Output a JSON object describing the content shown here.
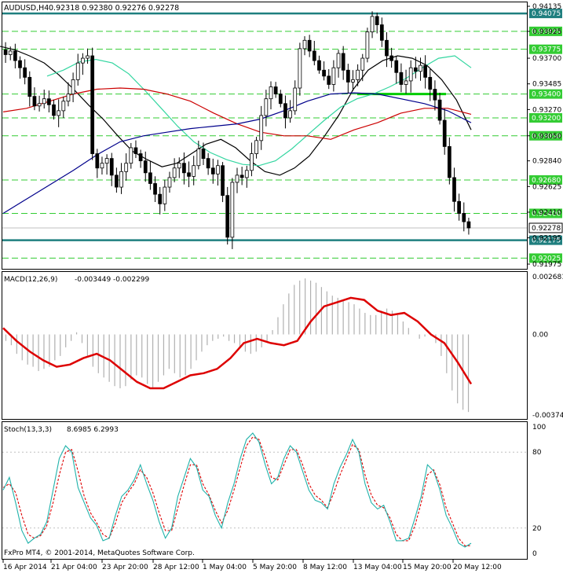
{
  "header": {
    "symbol": "AUDUSD,H4",
    "ohlc": "0.92318 0.92380 0.92276 0.92278"
  },
  "footer": {
    "copyright": "FxPro MT4, © 2001-2014, MetaQuotes Software Corp."
  },
  "chart_data": [
    {
      "type": "candlestick",
      "symbol": "AUDUSD",
      "timeframe": "H4",
      "ylim": [
        0.91975,
        0.94135
      ],
      "price_axis_labels": [
        "0.94135",
        "0.93925",
        "0.93700",
        "0.93485",
        "0.93270",
        "0.93050",
        "0.92840",
        "0.92625",
        "0.92410",
        "0.92195",
        "0.91975"
      ],
      "levels": [
        {
          "value": "0.94075",
          "style": "solid",
          "color": "#1f7f7f"
        },
        {
          "value": "0.93925",
          "style": "dashed",
          "color": "#33cc33"
        },
        {
          "value": "0.93775",
          "style": "dashed",
          "color": "#33cc33"
        },
        {
          "value": "0.93400",
          "style": "dashed",
          "color": "#33cc33"
        },
        {
          "value": "0.93200",
          "style": "dashed",
          "color": "#33cc33"
        },
        {
          "value": "0.93050",
          "style": "dashed",
          "color": "#33cc33"
        },
        {
          "value": "0.92680",
          "style": "dashed",
          "color": "#33cc33"
        },
        {
          "value": "0.92400",
          "style": "dashed",
          "color": "#33cc33"
        },
        {
          "value": "0.92175",
          "style": "solid",
          "color": "#1f7f7f"
        },
        {
          "value": "0.92025",
          "style": "dashed",
          "color": "#33cc33"
        }
      ],
      "current_price": "0.92278",
      "close_series": [
        0.9373,
        0.9376,
        0.9368,
        0.9362,
        0.9354,
        0.9338,
        0.933,
        0.9332,
        0.9336,
        0.9331,
        0.9322,
        0.9326,
        0.9334,
        0.934,
        0.9352,
        0.9366,
        0.937,
        0.9372,
        0.929,
        0.9278,
        0.9282,
        0.9286,
        0.9272,
        0.9262,
        0.9275,
        0.9282,
        0.9295,
        0.929,
        0.9284,
        0.9274,
        0.9265,
        0.9256,
        0.9248,
        0.9262,
        0.927,
        0.9278,
        0.9282,
        0.9274,
        0.9271,
        0.928,
        0.9294,
        0.9286,
        0.9278,
        0.9273,
        0.928,
        0.9255,
        0.922,
        0.9266,
        0.9272,
        0.927,
        0.9276,
        0.929,
        0.9301,
        0.9322,
        0.9336,
        0.9346,
        0.934,
        0.9332,
        0.932,
        0.9326,
        0.9345,
        0.9378,
        0.9385,
        0.9376,
        0.9368,
        0.936,
        0.9355,
        0.9348,
        0.9362,
        0.9374,
        0.936,
        0.935,
        0.9352,
        0.936,
        0.937,
        0.9392,
        0.9405,
        0.9398,
        0.9385,
        0.9372,
        0.9368,
        0.9358,
        0.9348,
        0.9351,
        0.9362,
        0.9359,
        0.9364,
        0.9354,
        0.9344,
        0.9335,
        0.9318,
        0.9296,
        0.927,
        0.925,
        0.924,
        0.9233,
        0.92278
      ],
      "moving_averages": [
        {
          "color": "#000000",
          "values": [
            0.938,
            0.9377,
            0.9372,
            0.9366,
            0.9356,
            0.9344,
            0.9331,
            0.9319,
            0.9305,
            0.9292,
            0.9285,
            0.9279,
            0.9282,
            0.929,
            0.9298,
            0.9302,
            0.9295,
            0.9284,
            0.9275,
            0.9272,
            0.9278,
            0.9288,
            0.9304,
            0.9322,
            0.9344,
            0.936,
            0.9368,
            0.9372,
            0.937,
            0.9364,
            0.9352,
            0.9335,
            0.931
          ]
        },
        {
          "color": "#33d6a0",
          "values": [
            0.9355,
            0.936,
            0.9367,
            0.9369,
            0.9366,
            0.9357,
            0.9343,
            0.9328,
            0.9313,
            0.93,
            0.9291,
            0.9285,
            0.9281,
            0.928,
            0.9284,
            0.9294,
            0.9306,
            0.9318,
            0.9329,
            0.9336,
            0.934,
            0.9346,
            0.9353,
            0.9362,
            0.937,
            0.9372,
            0.9362
          ]
        },
        {
          "color": "#cc0000",
          "values": [
            0.9325,
            0.9328,
            0.9334,
            0.934,
            0.9344,
            0.9345,
            0.9344,
            0.934,
            0.9334,
            0.9324,
            0.9315,
            0.9308,
            0.9305,
            0.9305,
            0.9302,
            0.931,
            0.9316,
            0.9324,
            0.9328,
            0.9328,
            0.9323
          ]
        },
        {
          "color": "#00008b",
          "values": [
            0.924,
            0.9252,
            0.9264,
            0.9276,
            0.9289,
            0.93,
            0.9305,
            0.9308,
            0.9311,
            0.9313,
            0.9315,
            0.9319,
            0.9326,
            0.9334,
            0.934,
            0.9341,
            0.934,
            0.9336,
            0.9332,
            0.9326,
            0.9316
          ]
        }
      ]
    },
    {
      "type": "bar",
      "indicator": "MACD(12,26,9)",
      "values_text": "-0.003449 -0.002299",
      "ylim": [
        -0.003741,
        0.002681
      ],
      "axis_labels": [
        "0.002681",
        "0.00",
        "-0.003741"
      ],
      "histogram": [
        -0.0003,
        -0.0005,
        -0.0009,
        -0.0012,
        -0.0014,
        -0.0015,
        -0.0017,
        -0.0016,
        -0.0015,
        -0.0012,
        -0.001,
        -0.0006,
        -0.0003,
        0.0001,
        -0.0004,
        -0.001,
        -0.0015,
        -0.0018,
        -0.002,
        -0.0022,
        -0.0024,
        -0.0025,
        -0.0024,
        -0.0021,
        -0.0019,
        -0.002,
        -0.0023,
        -0.0025,
        -0.0022,
        -0.0019,
        -0.0016,
        -0.0018,
        -0.002,
        -0.0019,
        -0.0016,
        -0.0012,
        -0.0008,
        -0.0005,
        -0.0003,
        -0.0002,
        -0.0001,
        -0.0003,
        -0.0004,
        -0.0006,
        -0.0008,
        -0.0009,
        -0.0008,
        -0.0006,
        -0.0003,
        0.0002,
        0.0008,
        0.0014,
        0.0019,
        0.0023,
        0.0025,
        0.0026,
        0.0025,
        0.0024,
        0.0022,
        0.002,
        0.0018,
        0.0017,
        0.0016,
        0.0015,
        0.0014,
        0.0012,
        0.001,
        0.0009,
        0.0009,
        0.0011,
        0.0012,
        0.0011,
        0.0009,
        0.0006,
        0.0003,
        0.0,
        -0.0002,
        -0.0001,
        0.0,
        -0.0004,
        -0.001,
        -0.0018,
        -0.0026,
        -0.0032,
        -0.0035,
        -0.0036
      ],
      "signal": [
        0.0003,
        -0.0003,
        -0.0008,
        -0.0012,
        -0.0015,
        -0.0014,
        -0.0011,
        -0.0009,
        -0.0012,
        -0.0017,
        -0.0022,
        -0.0025,
        -0.0025,
        -0.0022,
        -0.0019,
        -0.0018,
        -0.0016,
        -0.0011,
        -0.0004,
        -0.0002,
        -0.0004,
        -0.0005,
        -0.0003,
        0.0006,
        0.0013,
        0.0015,
        0.0017,
        0.0016,
        0.0011,
        0.0009,
        0.001,
        0.0006,
        0.0,
        -0.0004,
        -0.0013,
        -0.0023
      ]
    },
    {
      "type": "line",
      "indicator": "Stoch(13,3,3)",
      "values_text": "8.6985 6.2993",
      "ylim": [
        0,
        100
      ],
      "axis_labels": [
        "100",
        "80",
        "20",
        "0"
      ],
      "main": [
        50,
        60,
        40,
        18,
        8,
        12,
        15,
        25,
        50,
        75,
        85,
        80,
        52,
        40,
        28,
        22,
        10,
        12,
        30,
        45,
        50,
        58,
        70,
        55,
        42,
        25,
        12,
        20,
        45,
        60,
        75,
        68,
        50,
        45,
        30,
        20,
        40,
        55,
        75,
        90,
        95,
        88,
        70,
        55,
        60,
        75,
        85,
        80,
        65,
        50,
        42,
        40,
        35,
        55,
        68,
        78,
        90,
        80,
        55,
        40,
        35,
        38,
        25,
        10,
        10,
        12,
        28,
        45,
        70,
        65,
        50,
        30,
        20,
        8,
        5,
        8
      ],
      "signal": [
        52,
        55,
        48,
        30,
        15,
        12,
        14,
        22,
        40,
        62,
        80,
        82,
        65,
        45,
        32,
        24,
        15,
        12,
        24,
        40,
        48,
        55,
        66,
        60,
        48,
        32,
        18,
        18,
        36,
        54,
        70,
        70,
        55,
        46,
        34,
        24,
        34,
        50,
        68,
        85,
        92,
        90,
        76,
        60,
        58,
        70,
        82,
        82,
        70,
        55,
        46,
        42,
        36,
        48,
        62,
        74,
        86,
        82,
        62,
        46,
        38,
        36,
        28,
        15,
        10,
        10,
        22,
        40,
        62,
        66,
        54,
        36,
        24,
        12,
        6,
        6
      ]
    }
  ],
  "time_axis": [
    "16 Apr 2014",
    "21 Apr 04:00",
    "23 Apr 20:00",
    "28 Apr 12:00",
    "1 May 04:00",
    "5 May 20:00",
    "8 May 12:00",
    "13 May 04:00",
    "15 May 20:00",
    "20 May 12:00"
  ]
}
